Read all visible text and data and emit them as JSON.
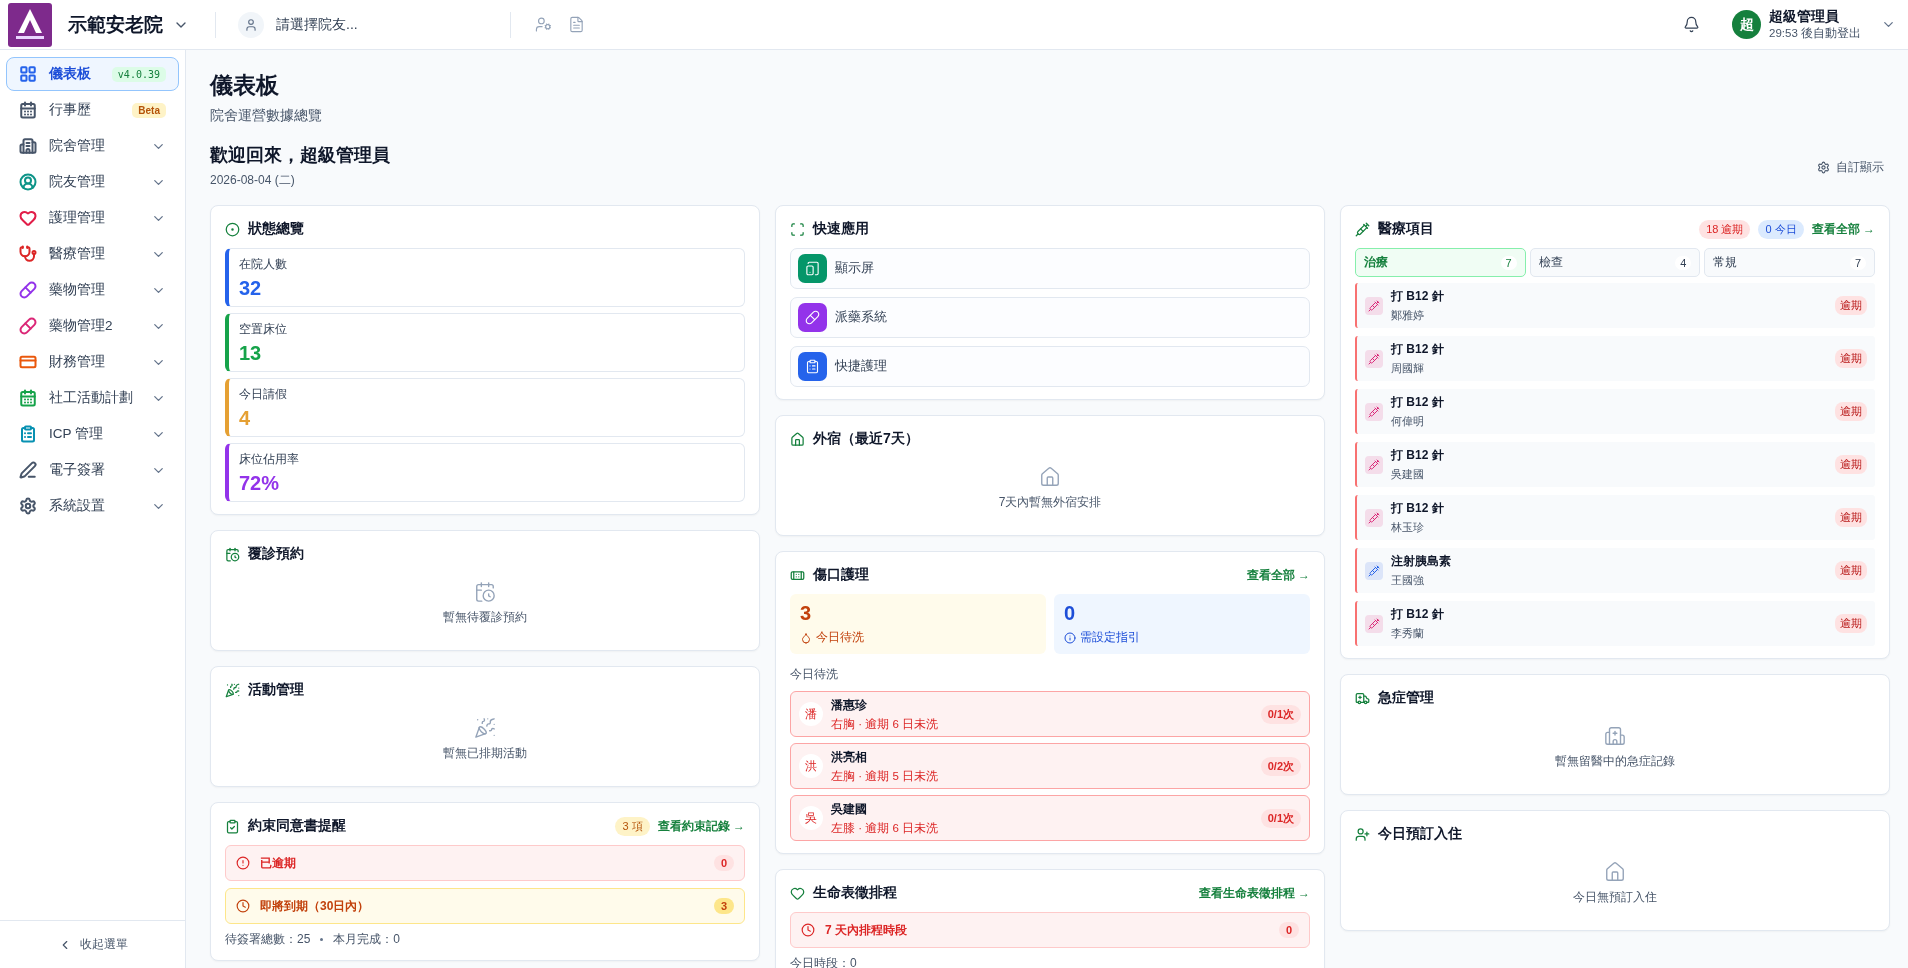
{
  "header": {
    "facility": "示範安老院",
    "resident_placeholder": "請選擇院友...",
    "user": {
      "avatar": "超",
      "name": "超級管理員",
      "session": "29:53 後自動登出"
    }
  },
  "sidebar": {
    "items": [
      {
        "label": "儀表板",
        "color": "#2563eb",
        "selected": true,
        "expandable": false,
        "badge": {
          "kind": "version",
          "text": "v4.0.39"
        }
      },
      {
        "label": "行事歷",
        "color": "#475569",
        "selected": false,
        "expandable": false,
        "badge": {
          "kind": "beta",
          "text": "Beta"
        }
      },
      {
        "label": "院舍管理",
        "color": "#475569",
        "selected": false,
        "expandable": true
      },
      {
        "label": "院友管理",
        "color": "#0d9488",
        "selected": false,
        "expandable": true
      },
      {
        "label": "護理管理",
        "color": "#e11d48",
        "selected": false,
        "expandable": true
      },
      {
        "label": "醫療管理",
        "color": "#dc2626",
        "selected": false,
        "expandable": true
      },
      {
        "label": "藥物管理",
        "color": "#9333ea",
        "selected": false,
        "expandable": true
      },
      {
        "label": "藥物管理2",
        "color": "#db2777",
        "selected": false,
        "expandable": true
      },
      {
        "label": "財務管理",
        "color": "#ea580c",
        "selected": false,
        "expandable": true
      },
      {
        "label": "社工活動計劃",
        "color": "#16a34a",
        "selected": false,
        "expandable": true
      },
      {
        "label": "ICP 管理",
        "color": "#0891b2",
        "selected": false,
        "expandable": true
      },
      {
        "label": "電子簽署",
        "color": "#475569",
        "selected": false,
        "expandable": true
      },
      {
        "label": "系統設置",
        "color": "#475569",
        "selected": false,
        "expandable": true
      }
    ],
    "collapse": "收起選單"
  },
  "page": {
    "title": "儀表板",
    "subtitle": "院舍運營數據總覽",
    "welcome": "歡迎回來，超級管理員",
    "date": "2026-08-04 (二)",
    "customize": "自訂顯示"
  },
  "status_overview": {
    "title": "狀態總覽",
    "stats": [
      {
        "label": "在院人數",
        "value": "32",
        "color": "#2563eb"
      },
      {
        "label": "空置床位",
        "value": "13",
        "color": "#16a34a"
      },
      {
        "label": "今日請假",
        "value": "4",
        "color": "#e5a033"
      },
      {
        "label": "床位佔用率",
        "value": "72%",
        "color": "#9333ea"
      }
    ]
  },
  "follow_up": {
    "title": "覆診預約",
    "empty": "暫無待覆診預約"
  },
  "activities": {
    "title": "活動管理",
    "empty": "暫無已排期活動"
  },
  "restraint": {
    "title": "約束同意書提醒",
    "badge": "3 項",
    "link": "查看約束記錄 →",
    "rows": [
      {
        "kind": "overdue",
        "label": "已逾期",
        "count": "0"
      },
      {
        "kind": "expiring",
        "label": "即將到期（30日內）",
        "count": "3"
      }
    ],
    "footer": [
      "待簽署總數：25",
      "本月完成：0"
    ]
  },
  "quick_apps": {
    "title": "快速應用",
    "items": [
      {
        "label": "顯示屏",
        "color": "#059669"
      },
      {
        "label": "派藥系統",
        "color": "#9333ea"
      },
      {
        "label": "快捷護理",
        "color": "#2563eb"
      }
    ]
  },
  "overnight": {
    "title": "外宿（最近7天）",
    "empty": "7天內暫無外宿安排"
  },
  "wound_care": {
    "title": "傷口護理",
    "link": "查看全部 →",
    "tiles": [
      {
        "kind": "pending",
        "value": "3",
        "label": "今日待洗"
      },
      {
        "kind": "guide",
        "value": "0",
        "label": "需設定指引"
      }
    ],
    "list_label": "今日待洗",
    "rows": [
      {
        "avatar": "潘",
        "name": "潘惠珍",
        "detail": "右胸 · 逾期 6 日未洗",
        "count": "0/1次"
      },
      {
        "avatar": "洪",
        "name": "洪亮相",
        "detail": "左胸 · 逾期 5 日未洗",
        "count": "0/2次"
      },
      {
        "avatar": "吳",
        "name": "吳建國",
        "detail": "左膝 · 逾期 6 日未洗",
        "count": "0/1次"
      }
    ]
  },
  "vital_signs": {
    "title": "生命表徵排程",
    "link": "查看生命表徵排程 →",
    "row": {
      "label": "7 天內排程時段",
      "count": "0"
    },
    "footer": "今日時段：0"
  },
  "medical_items": {
    "title": "醫療項目",
    "overdue_badge": "18 逾期",
    "today_badge": "0 今日",
    "link": "查看全部 →",
    "tabs": [
      {
        "label": "治療",
        "count": "7",
        "selected": true
      },
      {
        "label": "檢查",
        "count": "4",
        "selected": false
      },
      {
        "label": "常規",
        "count": "7",
        "selected": false
      }
    ],
    "rows": [
      {
        "title": "打 B12 針",
        "name": "鄭雅婷",
        "status": "逾期",
        "color": "#db2777"
      },
      {
        "title": "打 B12 針",
        "name": "周國輝",
        "status": "逾期",
        "color": "#db2777"
      },
      {
        "title": "打 B12 針",
        "name": "何偉明",
        "status": "逾期",
        "color": "#db2777"
      },
      {
        "title": "打 B12 針",
        "name": "吳建國",
        "status": "逾期",
        "color": "#db2777"
      },
      {
        "title": "打 B12 針",
        "name": "林玉珍",
        "status": "逾期",
        "color": "#db2777"
      },
      {
        "title": "注射胰島素",
        "name": "王國強",
        "status": "逾期",
        "color": "#2563eb"
      },
      {
        "title": "打 B12 針",
        "name": "李秀蘭",
        "status": "逾期",
        "color": "#db2777"
      }
    ]
  },
  "emergency": {
    "title": "急症管理",
    "empty": "暫無留醫中的急症記錄"
  },
  "admissions": {
    "title": "今日預訂入住",
    "empty": "今日無預訂入住"
  }
}
